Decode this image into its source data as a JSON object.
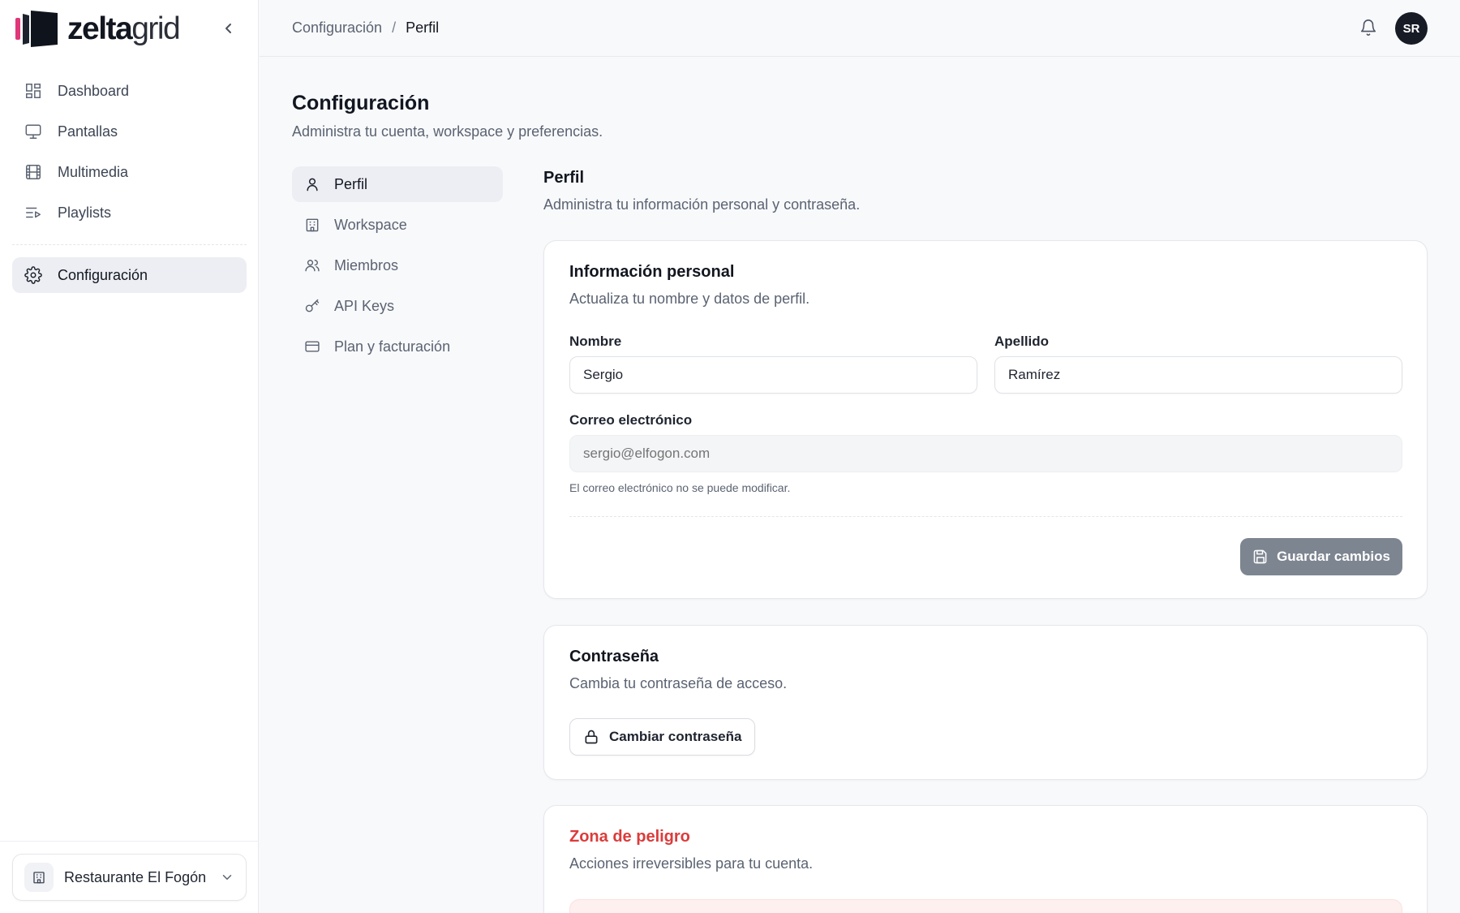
{
  "brand": {
    "name_bold": "zelta",
    "name_light": "grid",
    "accent_color": "#e0367a"
  },
  "sidebar": {
    "items": [
      {
        "label": "Dashboard",
        "icon": "dashboard-icon"
      },
      {
        "label": "Pantallas",
        "icon": "monitor-icon"
      },
      {
        "label": "Multimedia",
        "icon": "film-icon"
      },
      {
        "label": "Playlists",
        "icon": "playlist-icon"
      }
    ],
    "settings_item": {
      "label": "Configuración",
      "icon": "gear-icon",
      "active": true
    },
    "workspace": {
      "name": "Restaurante El Fogón",
      "icon": "building-icon"
    }
  },
  "topbar": {
    "breadcrumb": {
      "parent": "Configuración",
      "separator": "/",
      "current": "Perfil"
    },
    "avatar_initials": "SR"
  },
  "page": {
    "title": "Configuración",
    "subtitle": "Administra tu cuenta, workspace y preferencias."
  },
  "settings_nav": {
    "items": [
      {
        "label": "Perfil",
        "icon": "user-icon",
        "active": true
      },
      {
        "label": "Workspace",
        "icon": "building-icon"
      },
      {
        "label": "Miembros",
        "icon": "users-icon"
      },
      {
        "label": "API Keys",
        "icon": "key-icon"
      },
      {
        "label": "Plan y facturación",
        "icon": "credit-card-icon"
      }
    ]
  },
  "section": {
    "title": "Perfil",
    "subtitle": "Administra tu información personal y contraseña."
  },
  "personal_card": {
    "title": "Información personal",
    "description": "Actualiza tu nombre y datos de perfil.",
    "first_name": {
      "label": "Nombre",
      "value": "Sergio"
    },
    "last_name": {
      "label": "Apellido",
      "value": "Ramírez"
    },
    "email": {
      "label": "Correo electrónico",
      "placeholder": "sergio@elfogon.com",
      "hint": "El correo electrónico no se puede modificar."
    },
    "save_label": "Guardar cambios"
  },
  "password_card": {
    "title": "Contraseña",
    "description": "Cambia tu contraseña de acceso.",
    "button_label": "Cambiar contraseña"
  },
  "danger_card": {
    "title": "Zona de peligro",
    "description": "Acciones irreversibles para tu cuenta.",
    "color": "#dc3b3b"
  }
}
